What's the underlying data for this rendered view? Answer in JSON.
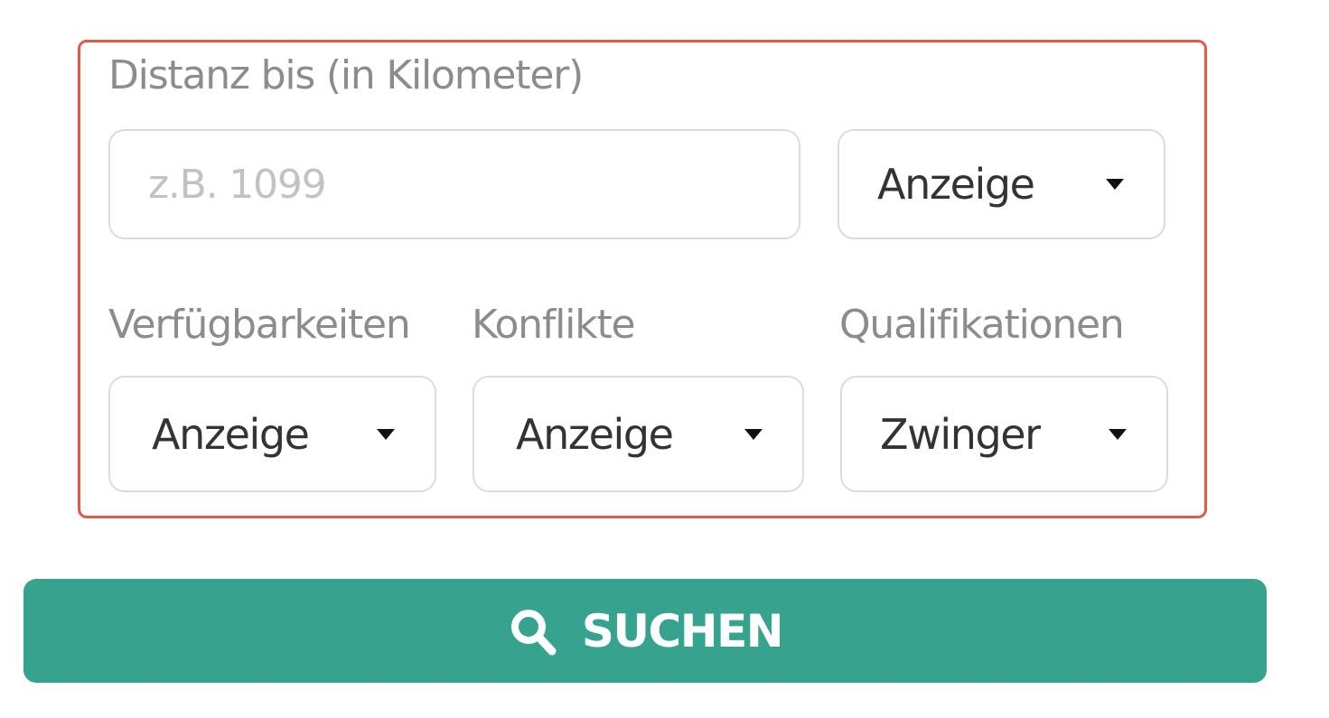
{
  "distance": {
    "label": "Distanz bis (in Kilometer)",
    "placeholder": "z.B. 1099",
    "value": "",
    "display_select": "Anzeige"
  },
  "filters": {
    "availability": {
      "label": "Verfügbarkeiten",
      "selected": "Anzeige"
    },
    "conflicts": {
      "label": "Konflikte",
      "selected": "Anzeige"
    },
    "qualifications": {
      "label": "Qualifikationen",
      "selected": "Zwinger"
    }
  },
  "search_button": {
    "label": "SUCHEN",
    "icon": "search-icon",
    "color": "#36a38e"
  },
  "colors": {
    "highlight_border": "#e05a47",
    "label_text": "#8c8c8c",
    "placeholder_text": "#c2c2c2"
  }
}
